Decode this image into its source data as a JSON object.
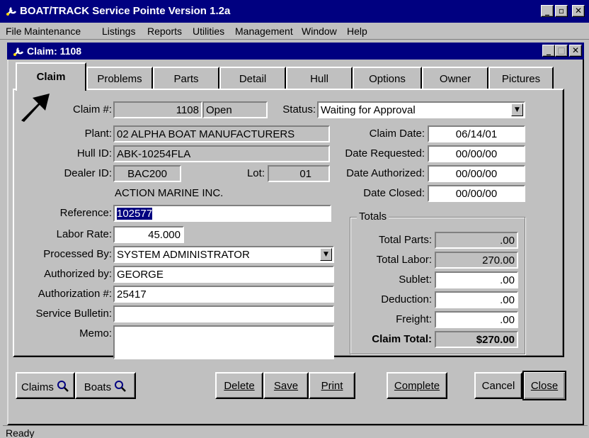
{
  "app": {
    "title": "BOAT/TRACK Service Pointe Version 1.2a"
  },
  "menu": [
    "File",
    "Maintenance",
    "Listings",
    "Reports",
    "Utilities",
    "Management",
    "Window",
    "Help"
  ],
  "window": {
    "title": "Claim: 1108"
  },
  "tabs": [
    "Claim",
    "Problems",
    "Parts",
    "Detail",
    "Hull",
    "Options",
    "Owner",
    "Pictures"
  ],
  "form": {
    "claim_no_label": "Claim #:",
    "claim_no": "1108",
    "claim_state": "Open",
    "status_label": "Status:",
    "status": "Waiting for Approval",
    "plant_label": "Plant:",
    "plant": "02  ALPHA BOAT MANUFACTURERS",
    "hull_label": "Hull ID:",
    "hull": "ABK-10254FLA",
    "dealer_label": "Dealer ID:",
    "dealer": "BAC200",
    "lot_label": "Lot:",
    "lot": "01",
    "dealer_name": "ACTION MARINE INC.",
    "reference_label": "Reference:",
    "reference": "102577",
    "labor_rate_label": "Labor Rate:",
    "labor_rate": "45.000",
    "processed_by_label": "Processed By:",
    "processed_by": "SYSTEM ADMINISTRATOR",
    "authorized_by_label": "Authorized by:",
    "authorized_by": "GEORGE",
    "authorization_no_label": "Authorization #:",
    "authorization_no": "25417",
    "service_bulletin_label": "Service Bulletin:",
    "service_bulletin": "",
    "memo_label": "Memo:",
    "memo": "",
    "claim_date_label": "Claim Date:",
    "claim_date": "06/14/01",
    "date_requested_label": "Date Requested:",
    "date_requested": "00/00/00",
    "date_authorized_label": "Date Authorized:",
    "date_authorized": "00/00/00",
    "date_closed_label": "Date Closed:",
    "date_closed": "00/00/00"
  },
  "totals": {
    "title": "Totals",
    "parts_label": "Total Parts:",
    "parts": ".00",
    "labor_label": "Total Labor:",
    "labor": "270.00",
    "sublet_label": "Sublet:",
    "sublet": ".00",
    "deduction_label": "Deduction:",
    "deduction": ".00",
    "freight_label": "Freight:",
    "freight": ".00",
    "claim_total_label": "Claim Total:",
    "claim_total": "$270.00"
  },
  "buttons": {
    "claims": "Claims",
    "boats": "Boats",
    "delete": "Delete",
    "save": "Save",
    "print": "Print",
    "complete": "Complete",
    "cancel": "Cancel",
    "close": "Close"
  },
  "status_bar": "Ready",
  "colors": {
    "titlebar": "#000080",
    "face": "#c0c0c0",
    "selection": "#000080"
  }
}
